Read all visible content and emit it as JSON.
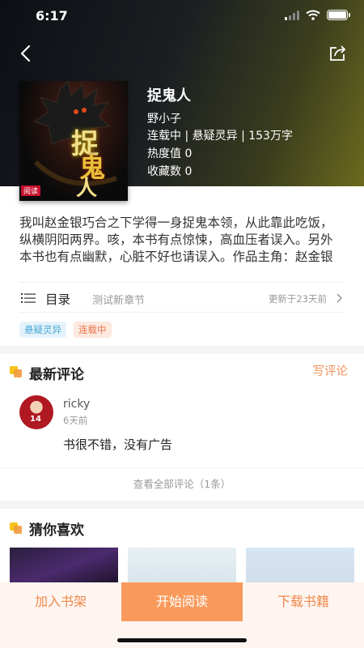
{
  "status": {
    "time": "6:17"
  },
  "book": {
    "title": "捉鬼人",
    "author": "野小子",
    "meta": "连载中 | 悬疑灵异 | 153万字",
    "heat": "热度值 0",
    "favorites": "收藏数 0",
    "cover_text": [
      "捉",
      "鬼",
      "人"
    ],
    "cover_tag": "阅读",
    "description": "我叫赵金银巧合之下学得一身捉鬼本领，从此靠此吃饭，纵横阴阳两界。咳，本书有点惊悚，高血压者误入。另外本书也有点幽默，心脏不好也请误入。作品主角：赵金银"
  },
  "toc": {
    "label": "目录",
    "latest_chapter": "测试新章节",
    "updated": "更新于23天前"
  },
  "tags": [
    "悬疑灵异",
    "连载中"
  ],
  "comments": {
    "title": "最新评论",
    "write_label": "写评论",
    "items": [
      {
        "user": "ricky",
        "time": "6天前",
        "text": "书很不错，没有广告",
        "avatar_number": "14"
      }
    ],
    "view_all": "查看全部评论（1条）"
  },
  "recommend": {
    "title": "猜你喜欢",
    "badges": [
      "",
      "",
      ""
    ]
  },
  "bottom": {
    "add_shelf": "加入书架",
    "start_read": "开始阅读",
    "download": "下载书籍"
  },
  "colors": {
    "accent": "#f99a5c",
    "accent_text": "#f08a4b",
    "tag_blue": "#49a8d5",
    "tag_orange": "#e8754d"
  }
}
